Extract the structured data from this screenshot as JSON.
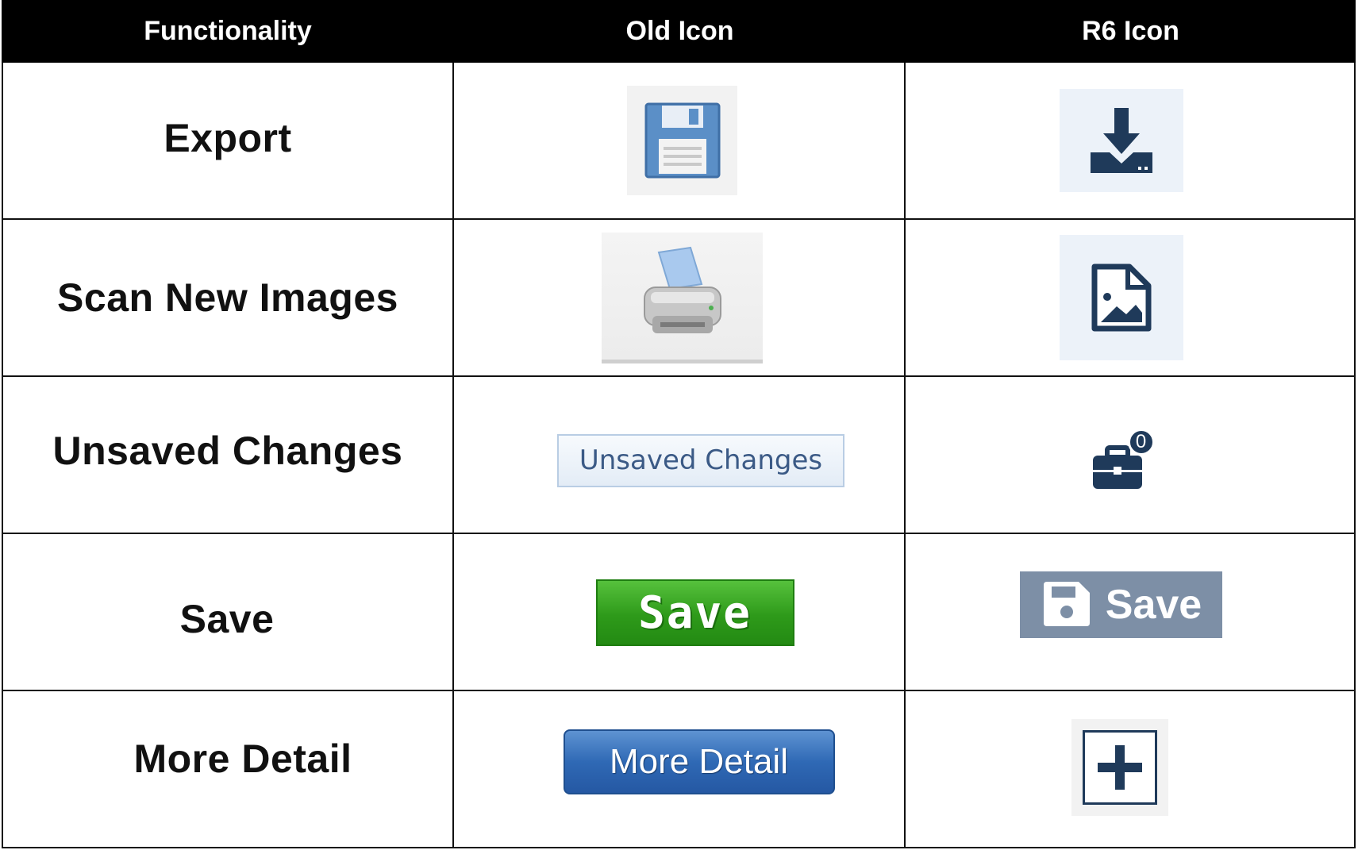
{
  "header": {
    "col1": "Functionality",
    "col2": "Old Icon",
    "col3": "R6 Icon"
  },
  "rows": [
    {
      "functionality": "Export",
      "old_icon": "floppy-disk-icon",
      "r6_icon": "download-icon"
    },
    {
      "functionality": "Scan New Images",
      "old_icon": "printer-icon",
      "r6_icon": "image-file-icon"
    },
    {
      "functionality": "Unsaved Changes",
      "old_button_label": "Unsaved Changes",
      "r6_icon": "briefcase-icon",
      "r6_badge": "0"
    },
    {
      "functionality": "Save",
      "old_button_label": "Save",
      "r6_button_label": "Save",
      "r6_icon": "save-icon"
    },
    {
      "functionality": "More Detail",
      "old_button_label": "More Detail",
      "r6_icon": "plus-icon"
    }
  ],
  "colors": {
    "header_bg": "#000000",
    "old_save_green": "#2e9a1a",
    "old_more_blue": "#2f69b5",
    "r6_navy": "#1f3a5a",
    "r6_save_gray": "#7d8fa6"
  }
}
